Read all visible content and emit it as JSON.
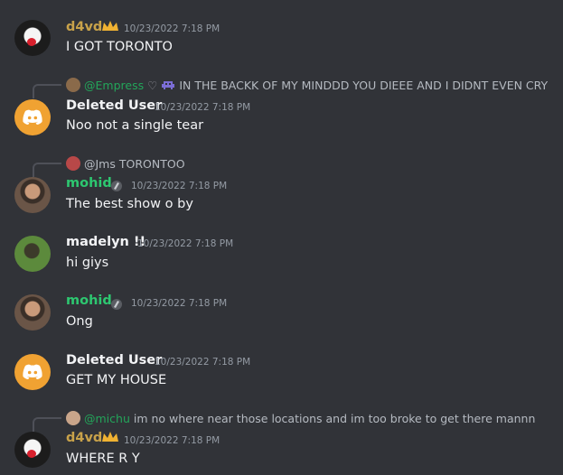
{
  "colors": {
    "background": "#313338",
    "green_name": "#2dc770",
    "gold_name": "#c8a24a"
  },
  "messages": [
    {
      "username": "d4vd",
      "time": "10/23/2022 7:18 PM",
      "text": "I GOT TORONTO"
    },
    {
      "reply": {
        "mention": "@Empress",
        "text": "IN THE BACKK OF MY MINDDD YOU DIEEE AND I DIDNT EVEN CRY"
      },
      "username": "Deleted User",
      "time": "10/23/2022 7:18 PM",
      "text": "Noo not a single tear"
    },
    {
      "reply": {
        "mention": "@Jms",
        "text": "TORONTOO"
      },
      "username": "mohid",
      "time": "10/23/2022 7:18 PM",
      "text": "The best show o by"
    },
    {
      "username": "madelyn !!",
      "time": "10/23/2022 7:18 PM",
      "text": "hi giys"
    },
    {
      "username": "mohid",
      "time": "10/23/2022 7:18 PM",
      "text": "Ong"
    },
    {
      "username": "Deleted User",
      "time": "10/23/2022 7:18 PM",
      "text": "GET MY HOUSE"
    },
    {
      "reply": {
        "mention": "@michu",
        "text": "im no where near those locations and im too broke to get there mannn"
      },
      "username": "d4vd",
      "time": "10/23/2022 7:18 PM",
      "text": "WHERE R Y"
    }
  ]
}
